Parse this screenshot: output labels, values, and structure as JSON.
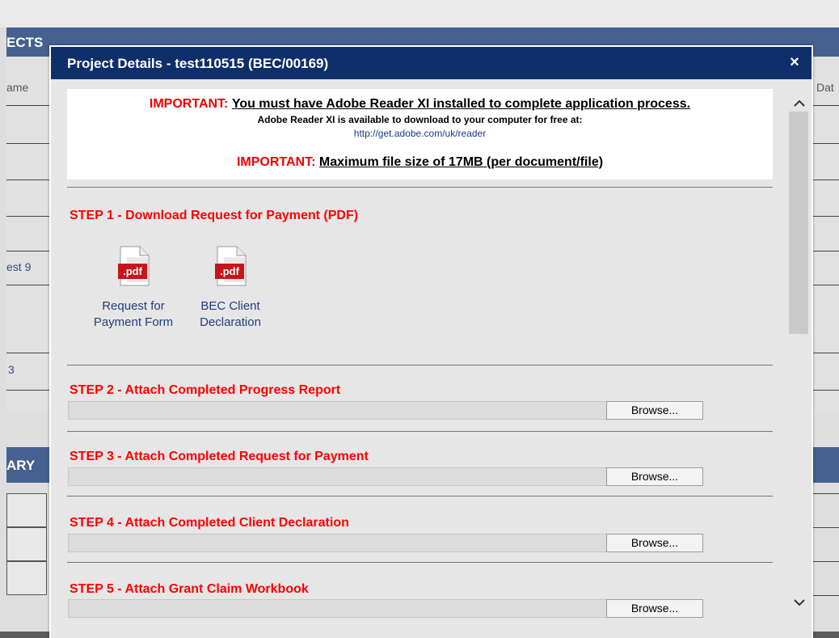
{
  "background": {
    "section1_header": "ECTS",
    "col_left": "ame",
    "col_right": "Dat",
    "link1": "est 9",
    "link2": "3",
    "section2_header": "ARY"
  },
  "modal": {
    "title": "Project Details - test110515 (BEC/00169)",
    "close_symbol": "×",
    "notice": {
      "important_label": "IMPORTANT:",
      "adobe_requirement": "You must have Adobe Reader XI installed to complete application process.",
      "download_info": "Adobe Reader XI is available to download to your computer for free at:",
      "download_url": "http://get.adobe.com/uk/reader",
      "important_label_2": "IMPORTANT:",
      "file_size_limit": "Maximum file size of 17MB (per document/file)"
    },
    "steps": [
      {
        "title": "STEP 1 - Download Request for Payment (PDF)"
      },
      {
        "title": "STEP 2 - Attach Completed Progress Report",
        "button": "Browse..."
      },
      {
        "title": "STEP 3 - Attach Completed Request for Payment",
        "button": "Browse..."
      },
      {
        "title": "STEP 4 - Attach Completed Client Declaration",
        "button": "Browse..."
      },
      {
        "title": "STEP 5 - Attach Grant Claim Workbook",
        "button": "Browse..."
      }
    ],
    "downloads": [
      {
        "badge": ".pdf",
        "line1": "Request for",
        "line2": "Payment Form"
      },
      {
        "badge": ".pdf",
        "line1": "BEC Client",
        "line2": "Declaration"
      }
    ]
  },
  "colors": {
    "modal_title_bg": "#0f2f6a",
    "header_bg": "#45618f",
    "step_red": "#ff0000",
    "pdf_badge": "#c4161c"
  },
  "icons": {
    "close": "close-icon",
    "pdf": "pdf-file-icon",
    "scroll_up": "chevron-up-icon",
    "scroll_down": "chevron-down-icon"
  }
}
